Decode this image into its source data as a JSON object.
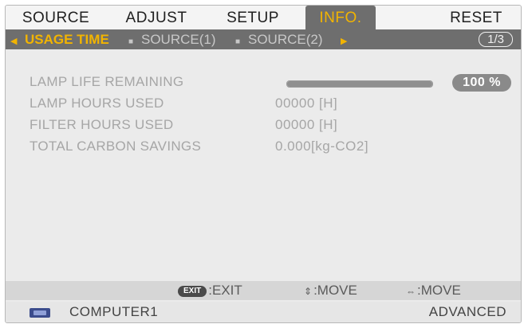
{
  "menu": {
    "tabs": [
      {
        "label": "SOURCE"
      },
      {
        "label": "ADJUST"
      },
      {
        "label": "SETUP"
      },
      {
        "label": "INFO."
      },
      {
        "label": "RESET"
      }
    ],
    "active_tab": "INFO."
  },
  "subtabs": {
    "items": [
      {
        "label": "USAGE TIME"
      },
      {
        "label": "SOURCE(1)"
      },
      {
        "label": "SOURCE(2)"
      }
    ],
    "active": "USAGE TIME",
    "page_indicator": "1/3"
  },
  "usage": {
    "lamp_life": {
      "label": "LAMP LIFE REMAINING",
      "percent": 100,
      "percent_text": "100 %"
    },
    "lamp_hours": {
      "label": "LAMP HOURS USED",
      "value": "00000 [H]"
    },
    "filter_hours": {
      "label": "FILTER HOURS USED",
      "value": "00000 [H]"
    },
    "carbon": {
      "label": "TOTAL CARBON SAVINGS",
      "value": "0.000[kg-CO2]"
    }
  },
  "footer": {
    "exit_key": "EXIT",
    "exit_label": ":EXIT",
    "move_updown_label": ":MOVE",
    "move_leftright_label": ":MOVE"
  },
  "status": {
    "source": "COMPUTER1",
    "mode": "ADVANCED"
  },
  "colors": {
    "accent": "#f2b400",
    "bar_bg": "#6e6e6e",
    "panel": "#ebebeb"
  }
}
